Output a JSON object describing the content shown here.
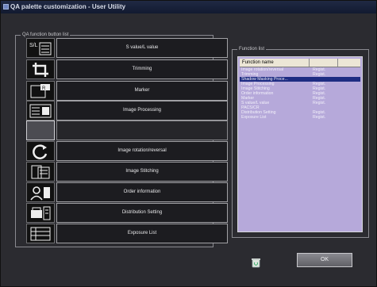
{
  "window": {
    "title": "QA palette customization - User Utility"
  },
  "qa_group": {
    "label": "QA function button list",
    "buttons": [
      {
        "icon": "sl-value-icon",
        "label": "S value/L value"
      },
      {
        "icon": "crop-icon",
        "label": "Trimming"
      },
      {
        "icon": "marker-icon",
        "label": "Marker"
      },
      {
        "icon": "image-processing-icon",
        "label": "Image Processing"
      },
      {
        "icon": "",
        "label": ""
      },
      {
        "icon": "rotate-icon",
        "label": "Image rotation/reversal"
      },
      {
        "icon": "stitching-icon",
        "label": "Image Stitching"
      },
      {
        "icon": "order-info-icon",
        "label": "Order information"
      },
      {
        "icon": "distribution-icon",
        "label": "Distribution Setting"
      },
      {
        "icon": "exposure-list-icon",
        "label": "Exposure List"
      }
    ]
  },
  "function_group": {
    "label": "Function list",
    "columns": [
      "Function name",
      "",
      ""
    ],
    "rows": [
      {
        "name": "Image rotation/reversal",
        "status": "Regist.",
        "selected": false
      },
      {
        "name": "Trimming",
        "status": "Regist.",
        "selected": false
      },
      {
        "name": "Shadow Masking Proce...",
        "status": "",
        "selected": true
      },
      {
        "name": "Image Processing",
        "status": "Regist.",
        "selected": false
      },
      {
        "name": "Image Stitching",
        "status": "Regist.",
        "selected": false
      },
      {
        "name": "Order information",
        "status": "Regist.",
        "selected": false
      },
      {
        "name": "Marker",
        "status": "Regist.",
        "selected": false
      },
      {
        "name": "S value/L value",
        "status": "Regist.",
        "selected": false
      },
      {
        "name": "PACS/CR",
        "status": "",
        "selected": false
      },
      {
        "name": "Distribution Setting",
        "status": "Regist.",
        "selected": false
      },
      {
        "name": "Exposure List",
        "status": "Regist.",
        "selected": false
      }
    ]
  },
  "ok_button": {
    "label": "OK"
  },
  "colors": {
    "list_bg": "#b6a9da",
    "selection": "#1e2c82",
    "title_bar": "#1a2340"
  }
}
